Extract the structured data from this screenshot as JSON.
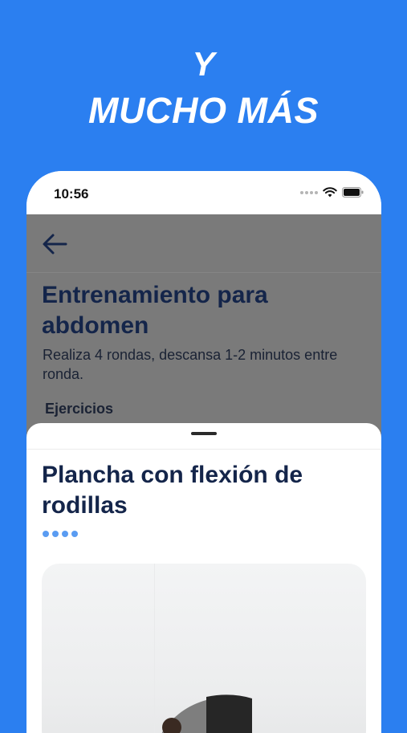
{
  "promo": {
    "line1": "Y",
    "line2": "MUCHO MÁS"
  },
  "status_bar": {
    "time": "10:56"
  },
  "workout": {
    "title": "Entrenamiento para abdomen",
    "description": "Realiza 4 rondas, descansa 1-2 minutos entre ronda.",
    "section_label": "Ejercicios"
  },
  "exercise_sheet": {
    "title": "Plancha con flexión de rodillas",
    "page_count": 4
  },
  "colors": {
    "brand_blue": "#2B7FF0",
    "title_navy": "#14254a",
    "overlay_gray": "#7a7a7a",
    "pager_blue": "#5a9cf2"
  },
  "icons": {
    "back": "back-arrow-icon",
    "wifi": "wifi-icon",
    "battery": "battery-icon",
    "signal": "signal-dots-icon"
  }
}
